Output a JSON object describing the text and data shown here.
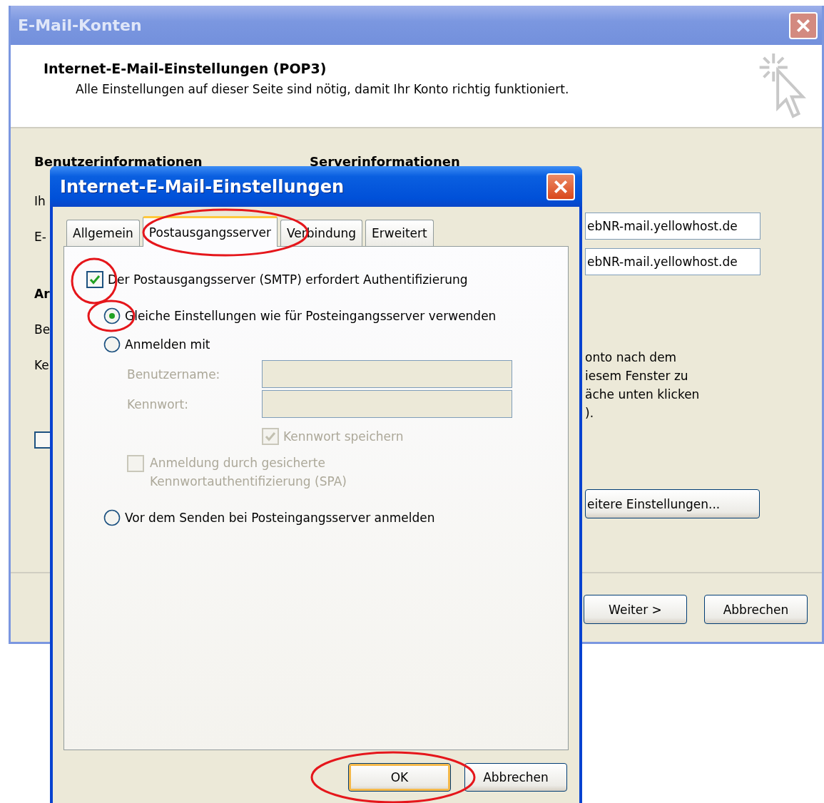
{
  "back_window": {
    "title": "E-Mail-Konten",
    "header": {
      "title": "Internet-E-Mail-Einstellungen (POP3)",
      "subtitle": "Alle Einstellungen auf dieser Seite sind nötig, damit Ihr Konto richtig funktioniert."
    },
    "sections": [
      "Benutzerinformationen",
      "Serverinformationen"
    ],
    "left_labels": [
      {
        "text": "Ih",
        "kind": "label"
      },
      {
        "text": "E-",
        "kind": "label"
      },
      {
        "text": "Ar",
        "kind": "heading"
      },
      {
        "text": "Be",
        "kind": "label"
      },
      {
        "text": "Ke",
        "kind": "label"
      }
    ],
    "left_checkbox": {
      "checked": false
    },
    "server_fields": [
      "ebNR-mail.yellowhost.de",
      "ebNR-mail.yellowhost.de"
    ],
    "description_lines": [
      "onto nach dem",
      "iesem Fenster zu",
      "äche unten klicken",
      ")."
    ],
    "more_settings_button": "eitere Einstellungen...",
    "buttons": [
      "Weiter >",
      "Abbrechen"
    ]
  },
  "dialog": {
    "title": "Internet-E-Mail-Einstellungen",
    "tabs": [
      {
        "label": "Allgemein",
        "selected": false
      },
      {
        "label": "Postausgangsserver",
        "selected": true
      },
      {
        "label": "Verbindung",
        "selected": false
      },
      {
        "label": "Erweitert",
        "selected": false
      }
    ],
    "auth_required": {
      "label": "Der Postausgangsserver (SMTP) erfordert Authentifizierung",
      "checked": true
    },
    "options": [
      {
        "label": "Gleiche Einstellungen wie für Posteingangsserver verwenden",
        "selected": true
      },
      {
        "label": "Anmelden mit",
        "selected": false
      },
      {
        "label": "Vor dem Senden bei Posteingangsserver anmelden",
        "selected": false
      }
    ],
    "login": {
      "disabled": true,
      "fields": [
        {
          "label": "Benutzername:"
        },
        {
          "label": "Kennwort:"
        }
      ],
      "save_password": {
        "label": "Kennwort speichern",
        "checked": true
      },
      "spa": {
        "label": "Anmeldung durch gesicherte Kennwortauthentifizierung (SPA)",
        "checked": false
      }
    },
    "buttons": [
      {
        "label": "OK",
        "default": true
      },
      {
        "label": "Abbrechen",
        "default": false
      }
    ]
  }
}
